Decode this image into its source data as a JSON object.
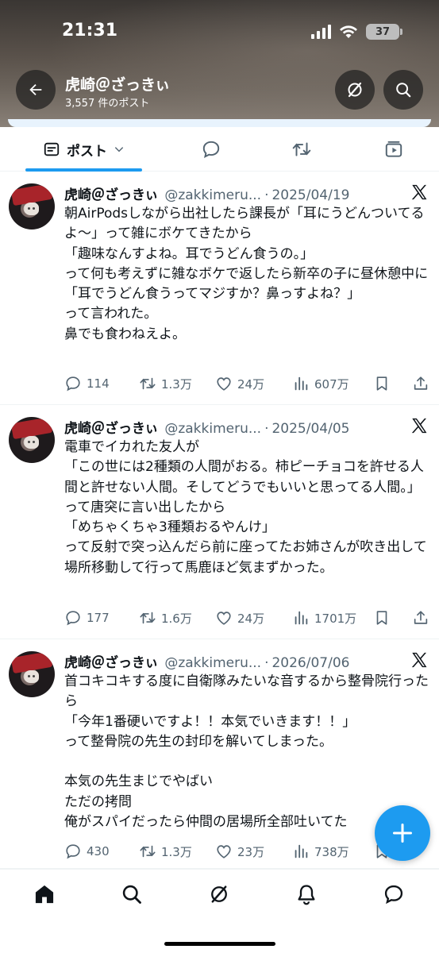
{
  "status_bar": {
    "time": "21:31",
    "battery": "37"
  },
  "header": {
    "title": "虎崎＠ざっきぃ",
    "subtitle": "3,557 件のポスト"
  },
  "tabs": {
    "posts_label": "ポスト"
  },
  "posts": [
    {
      "name": "虎崎＠ざっきぃ",
      "handle": "@zakkimeru...",
      "dot": "·",
      "date": "2025/04/19",
      "text": "朝AirPodsしながら出社したら課長が「耳にうどんついてるよ〜」って雑にボケてきたから\n「趣味なんすよね。耳でうどん食うの。」\nって何も考えずに雑なボケで返したら新卒の子に昼休憩中に\n「耳でうどん食うってマジすか？鼻っすよね？」\nって言われた。\n鼻でも食わねえよ。",
      "replies": "114",
      "reposts": "1.3万",
      "likes": "24万",
      "views": "607万"
    },
    {
      "name": "虎崎＠ざっきぃ",
      "handle": "@zakkimeru...",
      "dot": "·",
      "date": "2025/04/05",
      "text": "電車でイカれた友人が\n「この世には2種類の人間がおる。柿ピーチョコを許せる人間と許せない人間。そしてどうでもいいと思ってる人間。」\nって唐突に言い出したから\n「めちゃくちゃ3種類おるやんけ」\nって反射で突っ込んだら前に座ってたお姉さんが吹き出して場所移動して行って馬鹿ほど気まずかった。",
      "replies": "177",
      "reposts": "1.6万",
      "likes": "24万",
      "views": "1701万"
    },
    {
      "name": "虎崎＠ざっきぃ",
      "handle": "@zakkimeru...",
      "dot": "·",
      "date": "2026/07/06",
      "text": "首コキコキする度に自衛隊みたいな音するから整骨院行ったら\n「今年1番硬いですよ！！本気でいきます！！」\nって整骨院の先生の封印を解いてしまった。\n\n本気の先生まじでやばい\nただの拷問\n俺がスパイだったら仲間の居場所全部吐いてた",
      "replies": "430",
      "reposts": "1.3万",
      "likes": "23万",
      "views": "738万"
    }
  ],
  "colors": {
    "accent": "#1d9bf0",
    "text": "#0f1419",
    "muted": "#536471"
  },
  "icons": [
    "back-arrow-icon",
    "grok-icon",
    "search-icon",
    "posts-tab-icon",
    "chevron-down-icon",
    "reply-icon",
    "repost-icon",
    "like-icon",
    "views-icon",
    "bookmark-icon",
    "share-icon",
    "x-logo-icon",
    "compose-plus-icon",
    "home-icon",
    "notifications-icon",
    "messages-icon"
  ]
}
